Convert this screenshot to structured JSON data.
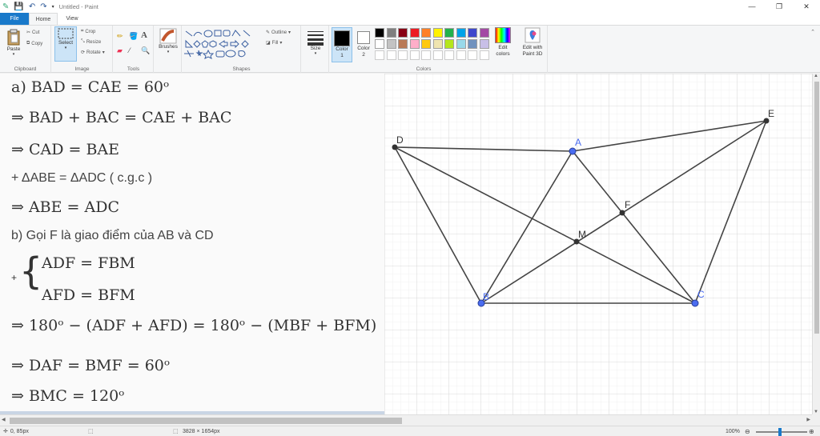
{
  "window": {
    "title": "Untitled - Paint",
    "buttons": [
      "—",
      "❐",
      "✕"
    ]
  },
  "tabs": [
    {
      "label": "File"
    },
    {
      "label": "Home"
    },
    {
      "label": "View"
    }
  ],
  "ribbon": {
    "clipboard": {
      "label": "Clipboard",
      "paste": "Paste",
      "cut": "Cut",
      "copy": "Copy"
    },
    "image": {
      "label": "Image",
      "select": "Select",
      "crop": "Crop",
      "resize": "Resize",
      "rotate": "Rotate"
    },
    "tools": {
      "label": "Tools"
    },
    "brushes": {
      "label": "Brushes"
    },
    "shapes": {
      "label": "Shapes",
      "outline": "Outline",
      "fill": "Fill"
    },
    "size": {
      "label": "Size"
    },
    "colors": {
      "label": "Colors",
      "color1": "Color 1",
      "color2": "Color 2",
      "edit_colors": "Edit colors",
      "edit_paint3d": "Edit with Paint 3D",
      "row1": [
        "#000000",
        "#7f7f7f",
        "#880015",
        "#ed1c24",
        "#ff7f27",
        "#fff200",
        "#22b14c",
        "#00a2e8",
        "#3f48cc",
        "#a349a4"
      ],
      "row2": [
        "#ffffff",
        "#c3c3c3",
        "#b97a57",
        "#ffaec9",
        "#ffc90e",
        "#efe4b0",
        "#b5e61d",
        "#99d9ea",
        "#7092be",
        "#c8bfe7"
      ]
    }
  },
  "math": {
    "l1": "a) BAD = CAE = 60ᵒ",
    "l2": "⇒ BAD + BAC = CAE + BAC",
    "l3": "⇒ CAD = BAE",
    "l4": "+ ΔABE = ΔADC ( c.g.c )",
    "l5": "⇒ ABE = ADC",
    "l6": "b) Gọi F là giao điểm của AB và CD",
    "l7a": "ADF = FBM",
    "l7b": "AFD = BFM",
    "l8": "⇒ 180ᵒ − (ADF + AFD) = 180ᵒ − (MBF + BFM)",
    "l9": "⇒ DAF = BMF = 60ᵒ",
    "l10": "⇒ BMC = 120ᵒ",
    "plus": "+"
  },
  "geometry": {
    "points": {
      "D": {
        "label": "D"
      },
      "A": {
        "label": "A"
      },
      "E": {
        "label": "E"
      },
      "F": {
        "label": "F"
      },
      "M": {
        "label": "M"
      },
      "B": {
        "label": "B"
      },
      "C": {
        "label": "C"
      }
    }
  },
  "status": {
    "cursor": "0, 85px",
    "dimensions": "3828 × 1654px",
    "zoom": "100%"
  }
}
